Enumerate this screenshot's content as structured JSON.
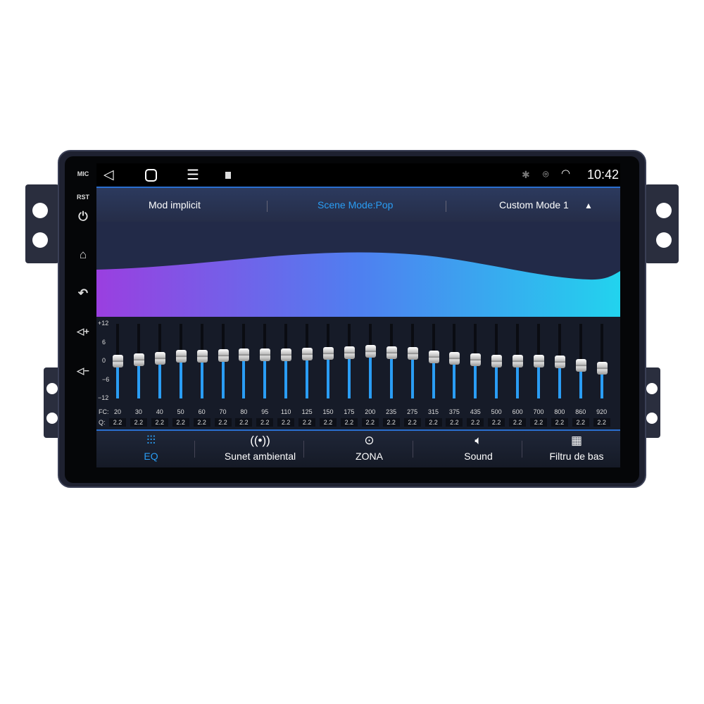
{
  "side_buttons": {
    "mic": "MIC",
    "rst": "RST"
  },
  "status": {
    "time": "10:42"
  },
  "mode_bar": {
    "left": "Mod implicit",
    "center": "Scene Mode:Pop",
    "right": "Custom Mode 1"
  },
  "eq": {
    "y_ticks": [
      "+12",
      "6",
      "0",
      "−6",
      "−12"
    ],
    "fc_label": "FC:",
    "q_label": "Q:",
    "range": [
      -12,
      12
    ],
    "bands": [
      {
        "fc": "20",
        "q": "2.2",
        "gain": 0
      },
      {
        "fc": "30",
        "q": "2.2",
        "gain": 0.5
      },
      {
        "fc": "40",
        "q": "2.2",
        "gain": 1
      },
      {
        "fc": "50",
        "q": "2.2",
        "gain": 1.5
      },
      {
        "fc": "60",
        "q": "2.2",
        "gain": 1.5
      },
      {
        "fc": "70",
        "q": "2.2",
        "gain": 1.7
      },
      {
        "fc": "80",
        "q": "2.2",
        "gain": 2
      },
      {
        "fc": "95",
        "q": "2.2",
        "gain": 2
      },
      {
        "fc": "110",
        "q": "2.2",
        "gain": 2
      },
      {
        "fc": "125",
        "q": "2.2",
        "gain": 2.3
      },
      {
        "fc": "150",
        "q": "2.2",
        "gain": 2.5
      },
      {
        "fc": "175",
        "q": "2.2",
        "gain": 2.7
      },
      {
        "fc": "200",
        "q": "2.2",
        "gain": 3.2
      },
      {
        "fc": "235",
        "q": "2.2",
        "gain": 2.8
      },
      {
        "fc": "275",
        "q": "2.2",
        "gain": 2.5
      },
      {
        "fc": "315",
        "q": "2.2",
        "gain": 1.3
      },
      {
        "fc": "375",
        "q": "2.2",
        "gain": 1
      },
      {
        "fc": "435",
        "q": "2.2",
        "gain": 0.4
      },
      {
        "fc": "500",
        "q": "2.2",
        "gain": 0
      },
      {
        "fc": "600",
        "q": "2.2",
        "gain": 0
      },
      {
        "fc": "700",
        "q": "2.2",
        "gain": 0
      },
      {
        "fc": "800",
        "q": "2.2",
        "gain": -0.2
      },
      {
        "fc": "860",
        "q": "2.2",
        "gain": -1.3
      },
      {
        "fc": "920",
        "q": "2.2",
        "gain": -2.3
      }
    ]
  },
  "tabs": [
    {
      "label": "EQ",
      "icon": "equalizer-icon",
      "active": true
    },
    {
      "label": "Sunet ambiental",
      "icon": "surround-icon"
    },
    {
      "label": "ZONA",
      "icon": "target-icon"
    },
    {
      "label": "Sound",
      "icon": "speaker-icon"
    },
    {
      "label": "Filtru de bas",
      "icon": "bass-filter-icon"
    }
  ],
  "colors": {
    "accent": "#2a9df4",
    "wave_start": "#9a3fe0",
    "wave_end": "#22d3ee"
  }
}
